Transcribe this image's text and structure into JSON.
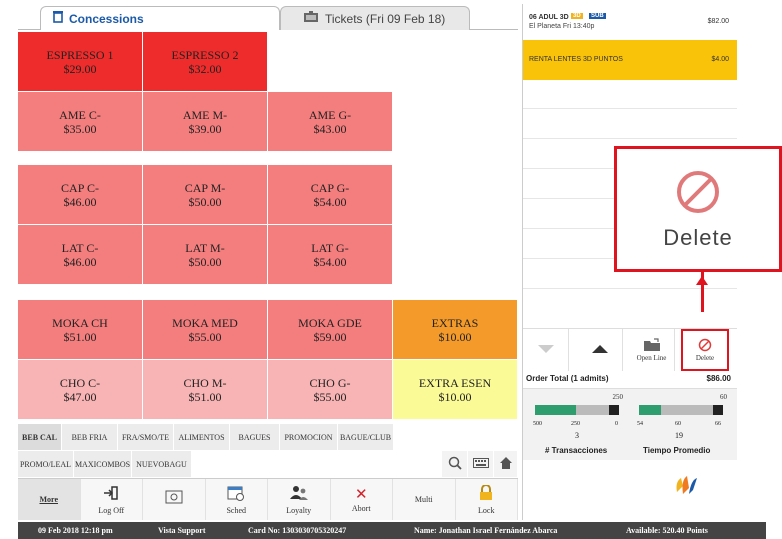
{
  "tabs": {
    "concessions": "Concessions",
    "tickets": "Tickets (Fri 09 Feb 18)"
  },
  "products": [
    {
      "name": "ESPRESSO 1",
      "price": "$29.00"
    },
    {
      "name": "ESPRESSO 2",
      "price": "$32.00"
    },
    {
      "name": "AME C-",
      "price": "$35.00"
    },
    {
      "name": "AME M-",
      "price": "$39.00"
    },
    {
      "name": "AME G-",
      "price": "$43.00"
    },
    {
      "name": "CAP C-",
      "price": "$46.00"
    },
    {
      "name": "CAP M-",
      "price": "$50.00"
    },
    {
      "name": "CAP G-",
      "price": "$54.00"
    },
    {
      "name": "LAT C-",
      "price": "$46.00"
    },
    {
      "name": "LAT M-",
      "price": "$50.00"
    },
    {
      "name": "LAT G-",
      "price": "$54.00"
    },
    {
      "name": "MOKA CH",
      "price": "$51.00"
    },
    {
      "name": "MOKA MED",
      "price": "$55.00"
    },
    {
      "name": "MOKA GDE",
      "price": "$59.00"
    },
    {
      "name": "EXTRAS",
      "price": "$10.00"
    },
    {
      "name": "CHO C-",
      "price": "$47.00"
    },
    {
      "name": "CHO M-",
      "price": "$51.00"
    },
    {
      "name": "CHO G-",
      "price": "$55.00"
    },
    {
      "name": "EXTRA ESEN",
      "price": "$10.00"
    }
  ],
  "categories_row1": [
    "BEB CAL",
    "BEB FRIA",
    "FRA/SMO/TE",
    "ALIMENTOS",
    "BAGUES",
    "PROMOCION",
    "BAGUE/CLUB"
  ],
  "categories_row2": [
    "PROMO/LEAL",
    "MAXICOMBOS",
    "NUEVOBAGU"
  ],
  "toolbar": {
    "more": "More",
    "logoff": "Log Off",
    "sched": "Sched",
    "loyalty": "Loyalty",
    "abort": "Abort",
    "multi": "Multi",
    "lock": "Lock"
  },
  "status": {
    "datetime": "09 Feb 2018 12:18 pm",
    "user": "Vista Support",
    "card": "Card No: 1303030705320247",
    "name": "Name: Jonathan Israel Fernández Abarca",
    "points": "Available: 520.40 Points"
  },
  "order": {
    "item1_line1": "06 ADUL 3D",
    "item1_badge1": "3D",
    "item1_badge2": "SUB",
    "item1_line2": "El Planeta Fri 13:40p",
    "item1_price": "$82.00",
    "item2_name": "RENTA LENTES 3D PUNTOS",
    "item2_price": "$4.00",
    "open_line": "Open Line",
    "delete": "Delete",
    "total_label": "Order Total (1 admits)",
    "total_value": "$86.00"
  },
  "gauges": {
    "g1": {
      "max": "250",
      "t0": "500",
      "t1": "250",
      "t2": "0",
      "value": "3",
      "label": "# Transacciones",
      "level": 0.55
    },
    "g2": {
      "max": "60",
      "t0": "54",
      "t1": "60",
      "t2": "66",
      "value": "19",
      "label": "Tiempo Promedio",
      "level": 0.3
    }
  },
  "callout": {
    "label": "Delete"
  },
  "colors": {
    "red": "#ee2c2c",
    "pink": "#f47e7e",
    "light_pink": "#f8b4b4",
    "orange": "#f39a2a",
    "yellow": "#fafa96",
    "order_highlight": "#f9c30a",
    "callout_border": "#e0141e"
  }
}
